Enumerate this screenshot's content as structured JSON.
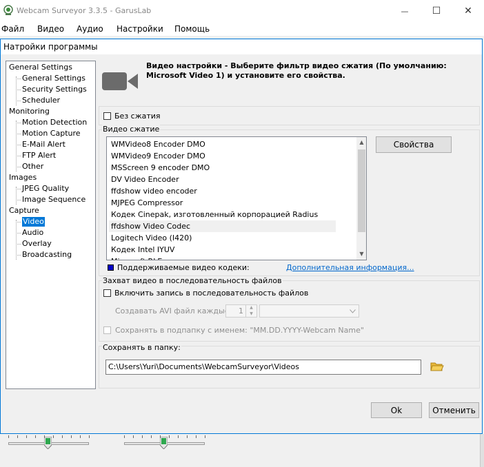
{
  "window": {
    "title": "Webcam Surveyor 3.3.5 - GarusLab",
    "minimize_glyph": "—",
    "maximize_glyph": "☐",
    "close_glyph": "✕"
  },
  "menu": {
    "items": [
      "Файл",
      "Видео",
      "Аудио",
      "Настройки",
      "Помощь"
    ]
  },
  "dialog": {
    "title": "Натройки программы",
    "tree": [
      {
        "label": "General Settings",
        "level": 0
      },
      {
        "label": "General Settings",
        "level": 1
      },
      {
        "label": "Security Settings",
        "level": 1
      },
      {
        "label": "Scheduler",
        "level": 1
      },
      {
        "label": "Monitoring",
        "level": 0
      },
      {
        "label": "Motion Detection",
        "level": 1
      },
      {
        "label": "Motion Capture",
        "level": 1
      },
      {
        "label": "E-Mail Alert",
        "level": 1
      },
      {
        "label": "FTP Alert",
        "level": 1
      },
      {
        "label": "Other",
        "level": 1
      },
      {
        "label": "Images",
        "level": 0
      },
      {
        "label": "JPEG Quality",
        "level": 1
      },
      {
        "label": "Image Sequence",
        "level": 1
      },
      {
        "label": "Capture",
        "level": 0
      },
      {
        "label": "Video",
        "level": 1,
        "selected": true
      },
      {
        "label": "Audio",
        "level": 1
      },
      {
        "label": "Overlay",
        "level": 1
      },
      {
        "label": "Broadcasting",
        "level": 1
      }
    ],
    "header": {
      "icon": "video-camera-icon",
      "description": "Видео настройки - Выберите фильтр видео сжатия (По умолчанию: Microsoft Video 1) и установите его свойства."
    },
    "no_compression": {
      "label": "Без сжатия",
      "checked": false
    },
    "video_compression": {
      "group_label": "Видео сжатие",
      "codecs": [
        "WMVideo8 Encoder DMO",
        "WMVideo9 Encoder DMO",
        "MSScreen 9 encoder DMO",
        "DV Video Encoder",
        "ffdshow video encoder",
        "MJPEG Compressor",
        "Кодек Cinepak, изготовленный корпорацией Radius",
        "ffdshow Video Codec",
        "Logitech Video (I420)",
        "Кодек Intel IYUV",
        "Microsoft RLE"
      ],
      "selected_index": 7,
      "properties_button": "Свойства",
      "legend_label": "Поддерживаемые видео кодеки:",
      "legend_color": "#0000c8",
      "more_info_link": "Дополнительная информация..."
    },
    "sequence_capture": {
      "group_label": "Захват видео в последовательность файлов",
      "enable_label": "Включить запись в последовательность файлов",
      "enable_checked": false,
      "create_every_label": "Создавать AVI файл каждые:",
      "create_every_value": "1",
      "subfolder_label": "Сохранять в подпапку с именем: \"MM.DD.YYYY-Webcam Name\"",
      "subfolder_checked": false
    },
    "save_folder": {
      "group_label": "Сохранять в папку:",
      "path": "C:\\Users\\Yuri\\Documents\\WebcamSurveyor\\Videos",
      "browse_icon": "folder-icon"
    },
    "buttons": {
      "ok": "Ok",
      "cancel": "Отменить"
    }
  },
  "colors": {
    "accent": "#0078d7",
    "link": "#0066cc"
  }
}
